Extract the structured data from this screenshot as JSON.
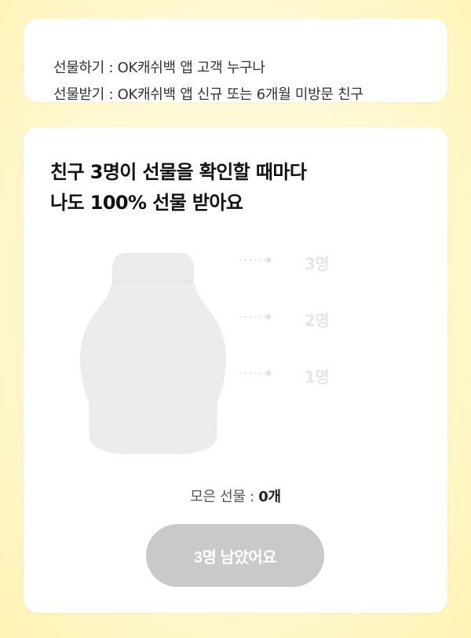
{
  "info": {
    "give_line": "선물하기 : OK캐쉬백 앱 고객 누구나",
    "receive_line": "선물받기 : OK캐쉬백 앱 신규 또는 6개월 미방문 친구"
  },
  "main": {
    "headline_line1": "친구 3명이 선물을 확인할 때마다",
    "headline_line2": "나도 100% 선물 받아요",
    "progress": {
      "levels": [
        "3명",
        "2명",
        "1명"
      ],
      "filled_fraction": 0
    },
    "collected_label": "모은 선물 : ",
    "collected_count": "0개",
    "remaining_button_label": "3명 남았어요"
  },
  "colors": {
    "background": "#fff8cf",
    "card": "#ffffff",
    "bottle": "#ececec",
    "button_disabled": "#c9c9c9"
  },
  "icons": {
    "bottle": "milk-bottle-icon"
  }
}
